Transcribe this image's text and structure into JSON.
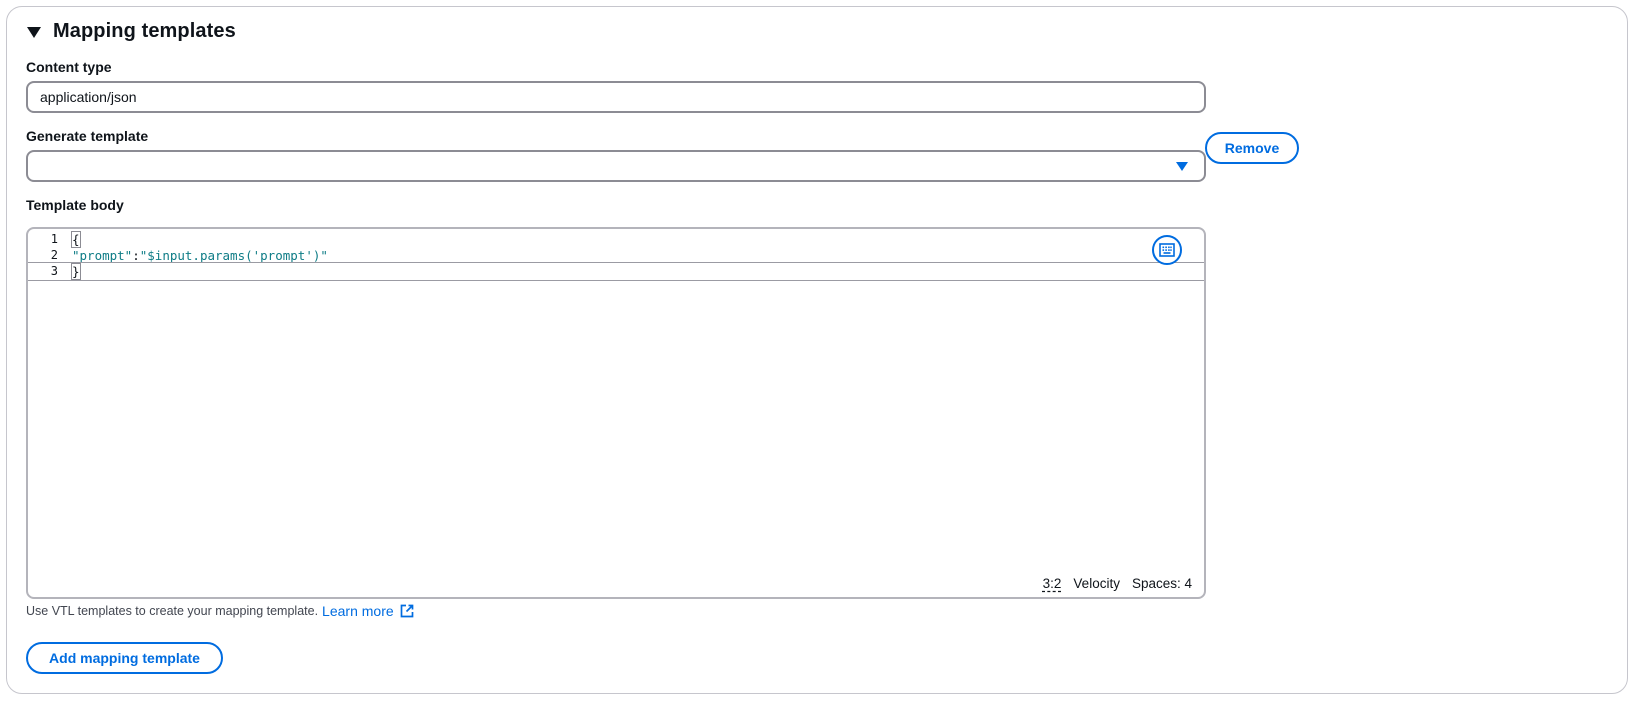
{
  "section": {
    "title": "Mapping templates"
  },
  "content_type": {
    "label": "Content type",
    "value": "application/json"
  },
  "generate_template": {
    "label": "Generate template",
    "value": ""
  },
  "remove_button": {
    "label": "Remove"
  },
  "template_body": {
    "label": "Template body",
    "lines": [
      {
        "num": "1",
        "text": "{"
      },
      {
        "num": "2",
        "key": "\"prompt\"",
        "colon": ":",
        "value": "\"$input.params('prompt')\""
      },
      {
        "num": "3",
        "text": "}"
      }
    ],
    "status": {
      "position": "3:2",
      "language": "Velocity",
      "spaces": "Spaces: 4"
    }
  },
  "help": {
    "text": "Use VTL templates to create your mapping template.",
    "link": "Learn more"
  },
  "add_button": {
    "label": "Add mapping template"
  },
  "colors": {
    "accent": "#006ce0",
    "string": "#0e7c86",
    "border": "#8c8c94"
  },
  "icons": [
    "caret-down-icon",
    "select-caret-icon",
    "keyboard-icon",
    "external-link-icon"
  ]
}
